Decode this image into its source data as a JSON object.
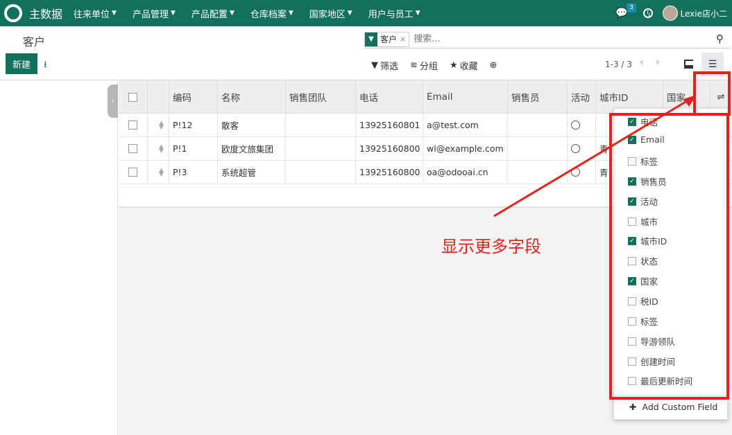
{
  "navbar": {
    "app_name": "主数据",
    "menu": [
      "往来单位",
      "产品管理",
      "产品配置",
      "仓库档案",
      "国家地区",
      "用户与员工"
    ],
    "badge": "3",
    "user": "Lexie店小二"
  },
  "control": {
    "breadcrumb": "客户",
    "facet": "客户",
    "search_placeholder": "搜索...",
    "new_label": "新建",
    "filter_label": "筛选",
    "group_label": "分组",
    "fav_label": "收藏",
    "pager": "1-3 / 3"
  },
  "table": {
    "headers": [
      "编码",
      "名称",
      "销售团队",
      "电话",
      "Email",
      "销售员",
      "活动",
      "城市ID",
      "国家"
    ],
    "rows": [
      {
        "code": "P!12",
        "name": "散客",
        "team": "",
        "phone": "13925160801",
        "email": "a@test.com",
        "sales": "",
        "city_id": ""
      },
      {
        "code": "P!1",
        "name": "欧度文旅集团",
        "team": "",
        "phone": "13925160800",
        "email": "wl@example.com",
        "sales": "",
        "city_id": "青"
      },
      {
        "code": "P!3",
        "name": "系统超管",
        "team": "",
        "phone": "13925160800",
        "email": "oa@odooai.cn",
        "sales": "",
        "city_id": "青"
      }
    ]
  },
  "dropdown": {
    "items": [
      {
        "label": "电话",
        "checked": true
      },
      {
        "label": "Email",
        "checked": true
      },
      {
        "label": "标签",
        "checked": false
      },
      {
        "label": "销售员",
        "checked": true
      },
      {
        "label": "活动",
        "checked": true
      },
      {
        "label": "城市",
        "checked": false
      },
      {
        "label": "城市ID",
        "checked": true
      },
      {
        "label": "状态",
        "checked": false
      },
      {
        "label": "国家",
        "checked": true
      },
      {
        "label": "税ID",
        "checked": false
      },
      {
        "label": "标签",
        "checked": false
      },
      {
        "label": "导游领队",
        "checked": false
      },
      {
        "label": "创建时间",
        "checked": false
      },
      {
        "label": "最后更新时间",
        "checked": false
      }
    ],
    "add_label": "Add Custom Field"
  },
  "annotation": {
    "text": "显示更多字段",
    "color": "#e8201c"
  },
  "colors": {
    "brand": "#12705d"
  }
}
